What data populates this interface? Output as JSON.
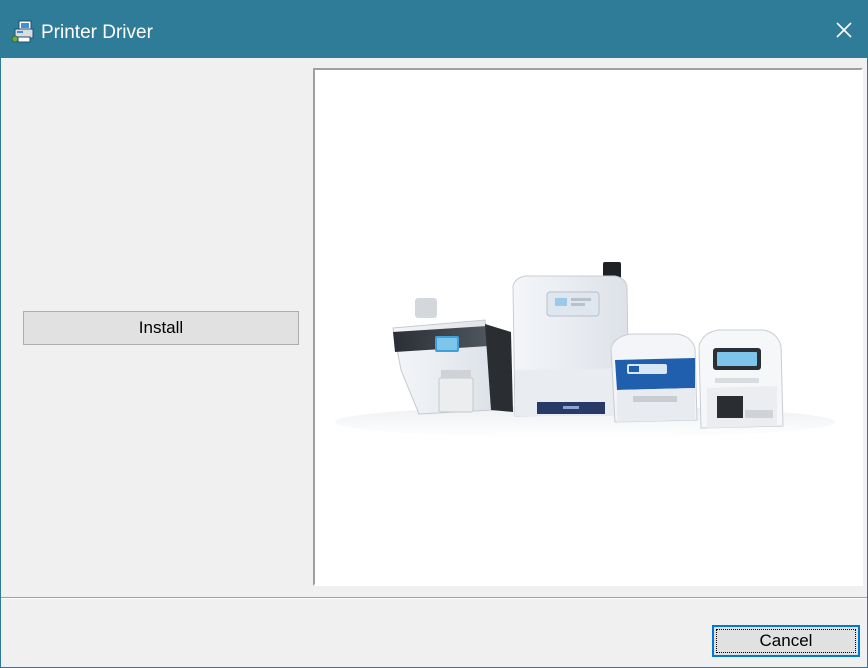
{
  "window": {
    "title": "Printer Driver",
    "title_icon": "printer-setup-icon",
    "close_icon": "close-icon"
  },
  "actions": {
    "install_label": "Install",
    "cancel_label": "Cancel"
  },
  "image_panel": {
    "content": "card-printers-product-photo"
  },
  "colors": {
    "titlebar": "#2e7c98",
    "client_background": "#f0f0f0",
    "button_face": "#e1e1e1",
    "focus_border": "#0078d7"
  }
}
